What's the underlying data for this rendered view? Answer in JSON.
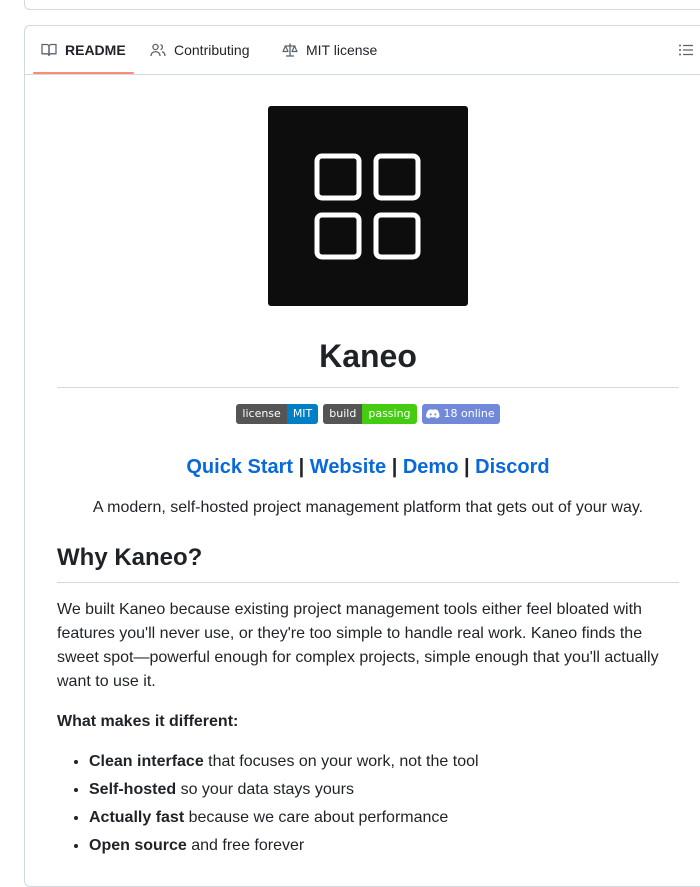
{
  "tabs": {
    "readme": "README",
    "contributing": "Contributing",
    "license": "MIT license"
  },
  "readme": {
    "title": "Kaneo",
    "badges": {
      "license": {
        "label": "license",
        "value": "MIT"
      },
      "build": {
        "label": "build",
        "value": "passing"
      },
      "discord": {
        "value": "18 online"
      }
    },
    "links": {
      "quick_start": "Quick Start",
      "website": "Website",
      "demo": "Demo",
      "discord": "Discord",
      "separator": "|"
    },
    "tagline": "A modern, self-hosted project management platform that gets out of your way.",
    "section_heading": "Why Kaneo?",
    "paragraph": "We built Kaneo because existing project management tools either feel bloated with features you'll never use, or they're too simple to handle real work. Kaneo finds the sweet spot—powerful enough for complex projects, simple enough that you'll actually want to use it.",
    "different_label": "What makes it different:",
    "features": [
      {
        "strong": "Clean interface",
        "rest": " that focuses on your work, not the tool"
      },
      {
        "strong": "Self-hosted",
        "rest": " so your data stays yours"
      },
      {
        "strong": "Actually fast",
        "rest": " because we care about performance"
      },
      {
        "strong": "Open source",
        "rest": " and free forever"
      }
    ]
  },
  "colors": {
    "tab_active_underline": "#fd8c73",
    "link": "#0969da",
    "badge_mit": "#007ec6",
    "badge_passing": "#44cc11",
    "badge_discord": "#7289da",
    "logo_bg": "#0d0d0d"
  },
  "icons": {
    "readme_tab": "book-icon",
    "contributing_tab": "people-icon",
    "license_tab": "law-icon",
    "toc": "list-unordered-icon",
    "logo": "kaneo-grid-logo"
  }
}
